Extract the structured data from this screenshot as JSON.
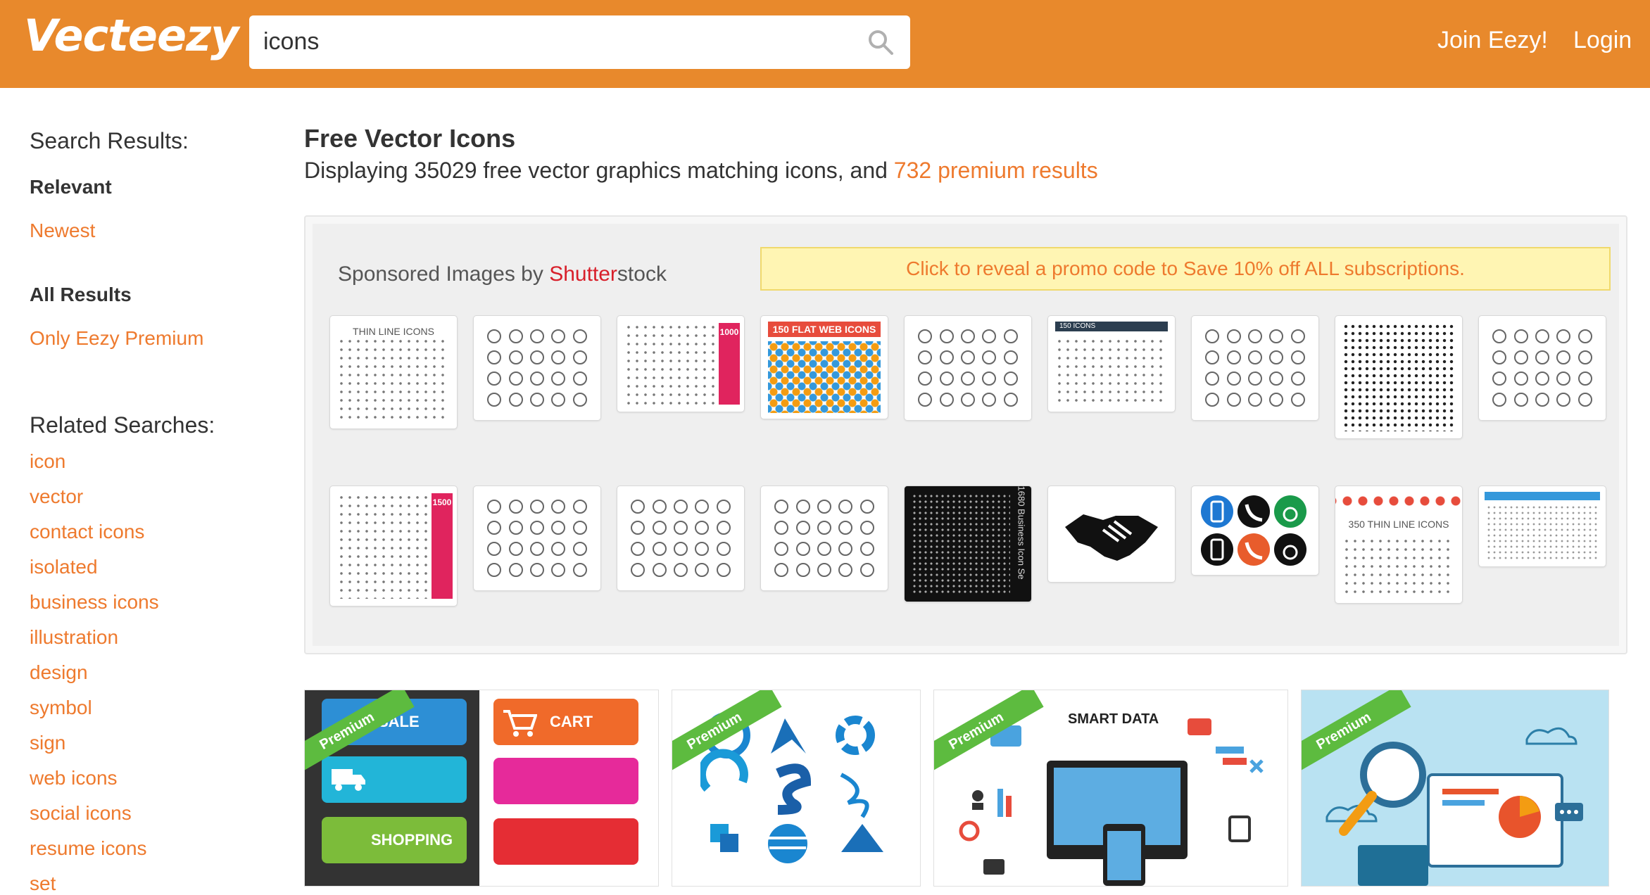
{
  "header": {
    "logo": "Vecteezy",
    "search_value": "icons",
    "join": "Join Eezy!",
    "login": "Login"
  },
  "sidebar": {
    "search_results_heading": "Search Results:",
    "relevant": "Relevant",
    "newest": "Newest",
    "all_results": "All Results",
    "only_premium": "Only Eezy Premium",
    "related_heading": "Related Searches:",
    "related": [
      "icon",
      "vector",
      "contact icons",
      "isolated",
      "business icons",
      "illustration",
      "design",
      "symbol",
      "sign",
      "web icons",
      "social icons",
      "resume icons",
      "set"
    ]
  },
  "main": {
    "title": "Free Vector Icons",
    "subtitle_prefix": "Displaying 35029 free vector graphics matching icons, and ",
    "subtitle_link": "732 premium results"
  },
  "sponsored": {
    "label_prefix": "Sponsored Images by ",
    "brand_a": "Shutter",
    "brand_b": "stock",
    "promo": "Click to reveal a promo code to Save 10% off ALL subscriptions.",
    "thumb_captions": {
      "t1": "THIN LINE ICONS",
      "t3_badge": "1000",
      "t4": "150 FLAT WEB ICONS",
      "t6": "150 ICONS",
      "t10_badge": "1500",
      "t14": "1680 Business Icon Se",
      "t17": "350 THIN LINE ICONS"
    }
  },
  "cards": {
    "premium": "Premium",
    "sale": "SALE",
    "cart": "CART",
    "shopping": "SHOPPING",
    "smart_data": "SMART DATA"
  },
  "colors": {
    "brand": "#e8892c",
    "link": "#ee7a2e",
    "ribbon": "#5dbb3f"
  }
}
